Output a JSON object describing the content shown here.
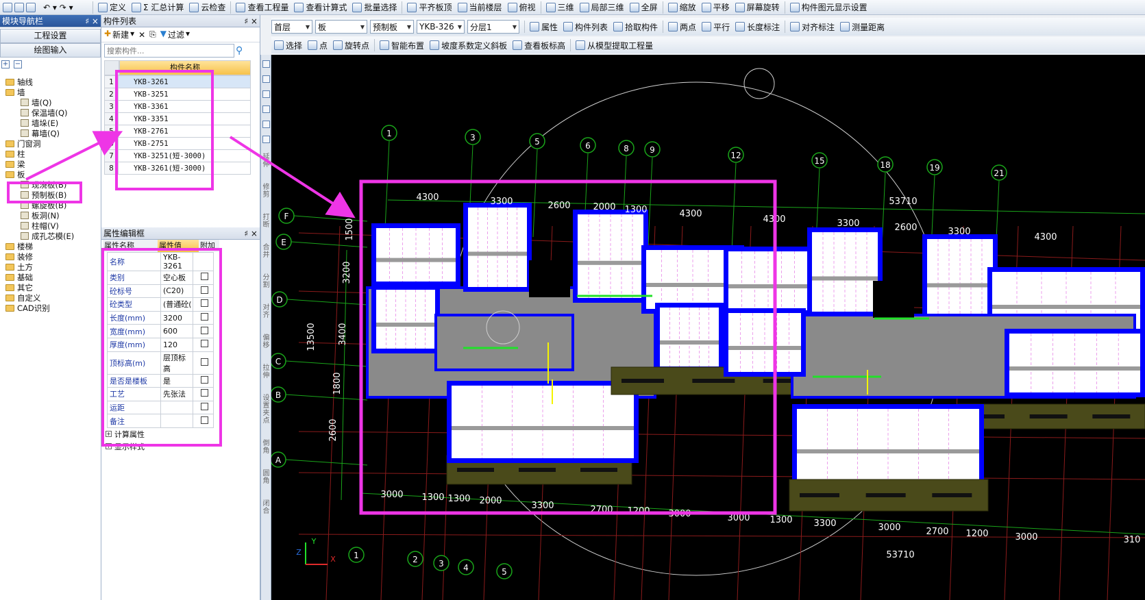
{
  "toolbar1": {
    "items": [
      "定义",
      "Σ 汇总计算",
      "云检查",
      "查看工程量",
      "查看计算式",
      "批量选择",
      "平齐板顶",
      "当前楼层",
      "俯视",
      "三维",
      "局部三维",
      "全屏",
      "缩放",
      "平移",
      "屏幕旋转",
      "构件图元显示设置"
    ]
  },
  "toolbar2": {
    "floor": "首层",
    "type": "板",
    "subtype": "预制板",
    "component": "YKB-326",
    "layer": "分层1",
    "items": [
      "属性",
      "构件列表",
      "拾取构件",
      "两点",
      "平行",
      "长度标注",
      "对齐标注",
      "测量距离"
    ]
  },
  "toolbar3": {
    "items": [
      "选择",
      "点",
      "旋转点",
      "智能布置",
      "坡度系数定义斜板",
      "查看板标高",
      "从模型提取工程量"
    ]
  },
  "nav": {
    "title": "模块导航栏",
    "pin": "♯ ×",
    "buttons": [
      "工程设置",
      "绘图输入"
    ],
    "tree": [
      {
        "label": "轴线",
        "level": 0
      },
      {
        "label": "墙",
        "level": 0
      },
      {
        "label": "墙(Q)",
        "level": 1
      },
      {
        "label": "保温墙(Q)",
        "level": 1
      },
      {
        "label": "墙垛(E)",
        "level": 1
      },
      {
        "label": "幕墙(Q)",
        "level": 1
      },
      {
        "label": "门窗洞",
        "level": 0
      },
      {
        "label": "柱",
        "level": 0
      },
      {
        "label": "梁",
        "level": 0
      },
      {
        "label": "板",
        "level": 0
      },
      {
        "label": "现浇板(B)",
        "level": 1
      },
      {
        "label": "预制板(B)",
        "level": 1
      },
      {
        "label": "螺旋板(B)",
        "level": 1
      },
      {
        "label": "板洞(N)",
        "level": 1
      },
      {
        "label": "柱帽(V)",
        "level": 1
      },
      {
        "label": "成孔芯模(E)",
        "level": 1
      },
      {
        "label": "楼梯",
        "level": 0
      },
      {
        "label": "装修",
        "level": 0
      },
      {
        "label": "土方",
        "level": 0
      },
      {
        "label": "基础",
        "level": 0
      },
      {
        "label": "其它",
        "level": 0
      },
      {
        "label": "自定义",
        "level": 0
      },
      {
        "label": "CAD识别",
        "level": 0
      }
    ]
  },
  "complist": {
    "title": "构件列表",
    "new_btn": "新建",
    "filter_btn": "过滤",
    "search_placeholder": "搜索构件...",
    "header": "构件名称",
    "rows": [
      "YKB-3261",
      "YKB-3251",
      "YKB-3361",
      "YKB-3351",
      "YKB-2761",
      "YKB-2751",
      "YKB-3251(短-3000)",
      "YKB-3261(短-3000)"
    ]
  },
  "props": {
    "title": "属性编辑框",
    "headers": [
      "属性名称",
      "属性值",
      "附加"
    ],
    "rows": [
      [
        "名称",
        "YKB-3261"
      ],
      [
        "类别",
        "空心板"
      ],
      [
        "砼标号",
        "(C20)"
      ],
      [
        "砼类型",
        "(普通砼("
      ],
      [
        "长度(mm)",
        "3200"
      ],
      [
        "宽度(mm)",
        "600"
      ],
      [
        "厚度(mm)",
        "120"
      ],
      [
        "顶标高(m)",
        "层顶标高"
      ],
      [
        "是否是楼板",
        "是"
      ],
      [
        "工艺",
        "先张法"
      ],
      [
        "运距",
        ""
      ],
      [
        "备注",
        ""
      ]
    ],
    "groups": [
      "计算属性",
      "显示样式"
    ]
  },
  "side_tools": [
    "延伸",
    "修剪",
    "打断",
    "合并",
    "分割",
    "对齐",
    "偏移",
    "拉伸",
    "设置夹点",
    "倒角",
    "圆角",
    "闭合"
  ],
  "cad": {
    "axis_top": [
      "1",
      "3",
      "5",
      "6",
      "8",
      "9",
      "12",
      "15",
      "18",
      "19",
      "21"
    ],
    "axis_left": [
      "F",
      "E",
      "D",
      "C",
      "B",
      "A"
    ],
    "axis_bottom": [
      "1",
      "2",
      "3",
      "4",
      "5"
    ],
    "dims_top": [
      "4300",
      "3300",
      "2600",
      "2000",
      "1300",
      "4300",
      "53710",
      "4300",
      "3300",
      "2600",
      "3300",
      "4300"
    ],
    "dims_left": [
      "1500",
      "3200",
      "3400",
      "13500",
      "1800",
      "2600"
    ],
    "dims_bottom": [
      "3000",
      "1300",
      "1300",
      "2000",
      "3300",
      "2700",
      "1200",
      "3000",
      "3000",
      "1300",
      "3300",
      "3000",
      "2700",
      "1200",
      "3000",
      "310",
      "53710"
    ]
  },
  "colors": {
    "highlight": "#ee35e6",
    "wall": "#0000ff",
    "slab": "#ffffff",
    "floor": "#8a8a8a",
    "axis": "#1aa51a",
    "dim": "#ffffff"
  }
}
